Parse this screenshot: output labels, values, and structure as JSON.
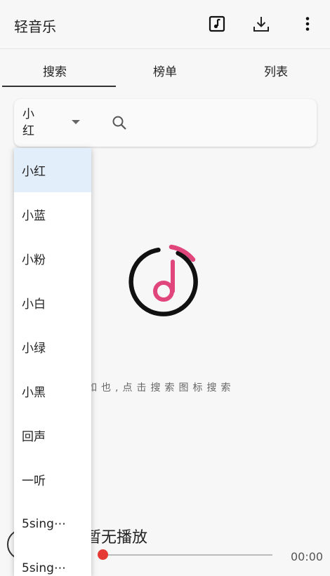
{
  "app": {
    "title": "轻音乐"
  },
  "appbar": {
    "icons": [
      "music-note-icon",
      "download-icon",
      "more-vert-icon"
    ]
  },
  "tabs": [
    {
      "label": "搜索",
      "active": true
    },
    {
      "label": "榜单"
    },
    {
      "label": "列表"
    }
  ],
  "search": {
    "selected_source": "小红"
  },
  "source_options": [
    "小红",
    "小蓝",
    "小粉",
    "小白",
    "小绿",
    "小黑",
    "回声",
    "一听",
    "5sing⋯",
    "5sing⋯"
  ],
  "empty_state": {
    "text": "空空如也,点击搜索图标搜索",
    "logo_colors": {
      "ring": "#111111",
      "accent": "#e0457b"
    }
  },
  "player": {
    "status": "暂无播放",
    "time": "00:00",
    "progress": 0
  },
  "colors": {
    "accent": "#e53935",
    "selected_row": "#e3eefb"
  }
}
